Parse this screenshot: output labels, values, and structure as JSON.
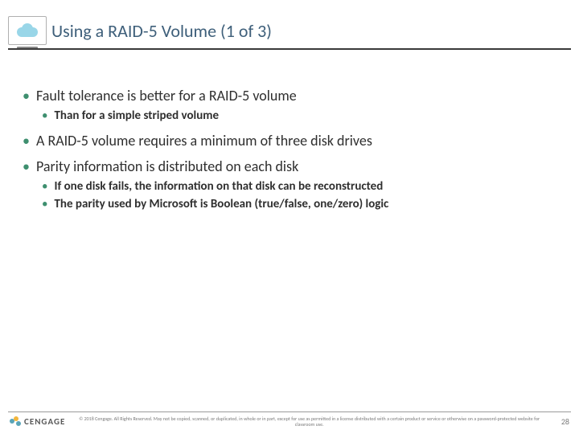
{
  "header": {
    "title": "Using a RAID-5 Volume (1 of 3)",
    "icon": "cloud-icon"
  },
  "bullets": [
    {
      "level": 1,
      "text": "Fault tolerance is better for a RAID-5 volume",
      "children": [
        {
          "level": 2,
          "text": "Than for a simple striped volume"
        }
      ]
    },
    {
      "level": 1,
      "text": "A RAID-5 volume requires a minimum of three disk drives",
      "children": []
    },
    {
      "level": 1,
      "text": "Parity information is distributed on each disk",
      "children": [
        {
          "level": 2,
          "text": "If one disk fails, the information on that disk can be reconstructed"
        },
        {
          "level": 2,
          "text": "The parity used by Microsoft is Boolean (true/false, one/zero) logic"
        }
      ]
    }
  ],
  "footer": {
    "brand": "CENGAGE",
    "copyright": "© 2018 Cengage. All Rights Reserved. May not be copied, scanned, or duplicated, in whole or in part, except for use as permitted in a license distributed with a certain product or service or otherwise on a password-protected website for classroom use.",
    "page": "28"
  }
}
